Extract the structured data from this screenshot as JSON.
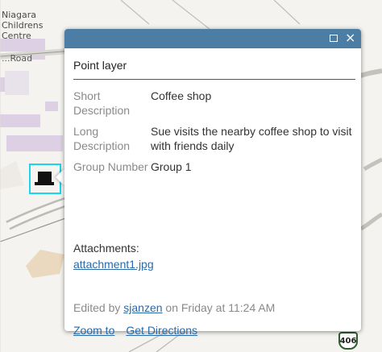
{
  "map": {
    "labels": {
      "niagara_line1": "Niagara",
      "niagara_line2": "Childrens",
      "niagara_line3": "Centre",
      "road": "...Road"
    },
    "highway_shield": "406",
    "colors": {
      "road_main": "#c9c8c3",
      "road_outline": "#9b9a95",
      "parcel_purple": "#ddd0e5",
      "parcel_tan": "#ead8bf",
      "selection": "#17d7f0",
      "highway_green": "#2f5d2f"
    }
  },
  "popup": {
    "titlebar_color": "#4c7da5",
    "maximize_icon": "maximize-icon",
    "close_icon": "close-icon",
    "close_symbol": "×",
    "layer_title": "Point layer",
    "attributes": [
      {
        "name": "Short Description",
        "value": "Coffee shop"
      },
      {
        "name": "Long Description",
        "value": "Sue visits the nearby coffee shop to visit with friends daily"
      },
      {
        "name": "Group Number",
        "value": "Group 1"
      }
    ],
    "attachments_label": "Attachments:",
    "attachment_file": "attachment1.jpg",
    "edited_prefix": "Edited by ",
    "edited_user": "sjanzen",
    "edited_suffix": " on Friday at 11:24 AM",
    "actions": {
      "zoom_to": "Zoom to",
      "get_directions": "Get Directions"
    }
  }
}
